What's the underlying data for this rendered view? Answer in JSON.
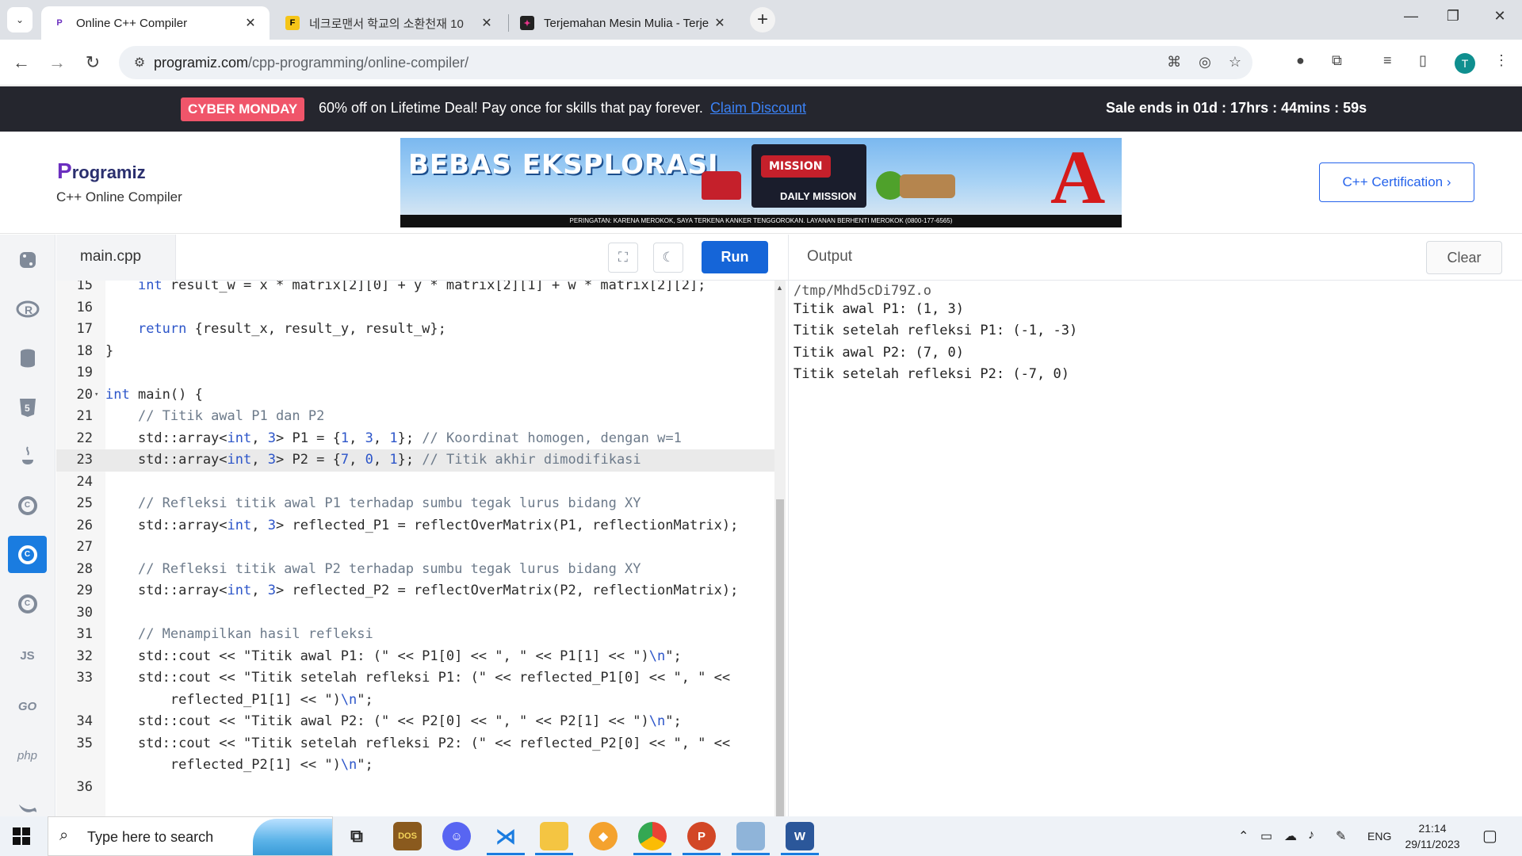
{
  "browser": {
    "tabs": [
      {
        "title": "Online C++ Compiler",
        "active": true,
        "favicon": "programiz-icon"
      },
      {
        "title": "네크로맨서 학교의 소환천재 10",
        "active": false,
        "favicon": "webtoon-icon"
      },
      {
        "title": "Terjemahan Mesin Mulia - Terje",
        "active": false,
        "favicon": "site-icon"
      }
    ],
    "url_domain": "programiz.com",
    "url_path": "/cpp-programming/online-compiler/",
    "profile_initial": "T"
  },
  "promo": {
    "badge": "CYBER MONDAY",
    "message": "60% off on Lifetime Deal! Pay once for skills that pay forever.",
    "link": "Claim Discount",
    "timer": "Sale ends in 01d : 17hrs : 44mins : 59s"
  },
  "header": {
    "logo_p": "P",
    "logo_rest": "rogramiz",
    "subtitle": "C++ Online Compiler",
    "cert_button": "C++ Certification ›"
  },
  "ad": {
    "title": "BEBAS EKSPLORASI",
    "mission": "MISSION",
    "daily": "DAILY MISSION",
    "brand": "A",
    "warning": "PERINGATAN: KARENA MEROKOK, SAYA TERKENA KANKER TENGGOROKAN. LAYANAN BERHENTI MEROKOK (0800-177-6565)"
  },
  "sidebar": {
    "langs": [
      "python",
      "r",
      "sql",
      "html",
      "java",
      "c",
      "cpp",
      "csharp",
      "JS",
      "GO",
      "php",
      "swift"
    ],
    "js_label": "JS",
    "go_label": "GO",
    "php_label": "php"
  },
  "editor": {
    "file_name": "main.cpp",
    "run_label": "Run",
    "lines": [
      {
        "n": "15",
        "html": "    <span class=\"kw\">int</span> result_w = x * matrix[2][0] + y * matrix[2][1] + w * matrix[2][2];"
      },
      {
        "n": "16",
        "html": ""
      },
      {
        "n": "17",
        "html": "    <span class=\"kw\">return</span> {result_x, result_y, result_w};"
      },
      {
        "n": "18",
        "html": "}"
      },
      {
        "n": "19",
        "html": ""
      },
      {
        "n": "20",
        "html": "<span class=\"kw\">int</span> main() {",
        "fold": true
      },
      {
        "n": "21",
        "html": "    <span class=\"cm\">// Titik awal P1 dan P2</span>"
      },
      {
        "n": "22",
        "html": "    std::array&lt;<span class=\"kw\">int</span>, <span class=\"kw\">3</span>&gt; P1 = {<span class=\"kw\">1</span>, <span class=\"kw\">3</span>, <span class=\"kw\">1</span>}; <span class=\"cm\">// Koordinat homogen, dengan w=1</span>"
      },
      {
        "n": "23",
        "html": "    std::array&lt;<span class=\"kw\">int</span>, <span class=\"kw\">3</span>&gt; P2 = {<span class=\"kw\">7</span>, <span class=\"kw\">0</span>, <span class=\"kw\">1</span>}; <span class=\"cm\">// Titik akhir dimodifikasi</span>",
        "highlight": true
      },
      {
        "n": "24",
        "html": ""
      },
      {
        "n": "25",
        "html": "    <span class=\"cm\">// Refleksi titik awal P1 terhadap sumbu tegak lurus bidang XY</span>"
      },
      {
        "n": "26",
        "html": "    std::array&lt;<span class=\"kw\">int</span>, <span class=\"kw\">3</span>&gt; reflected_P1 = reflectOverMatrix(P1, reflectionMatrix);"
      },
      {
        "n": "27",
        "html": ""
      },
      {
        "n": "28",
        "html": "    <span class=\"cm\">// Refleksi titik awal P2 terhadap sumbu tegak lurus bidang XY</span>"
      },
      {
        "n": "29",
        "html": "    std::array&lt;<span class=\"kw\">int</span>, <span class=\"kw\">3</span>&gt; reflected_P2 = reflectOverMatrix(P2, reflectionMatrix);"
      },
      {
        "n": "30",
        "html": ""
      },
      {
        "n": "31",
        "html": "    <span class=\"cm\">// Menampilkan hasil refleksi</span>"
      },
      {
        "n": "32",
        "html": "    std::cout &lt;&lt; \"Titik awal P1: (\" &lt;&lt; P1[0] &lt;&lt; \", \" &lt;&lt; P1[1] &lt;&lt; \")<span class=\"kw\">\\n</span>\";"
      },
      {
        "n": "33",
        "html": "    std::cout &lt;&lt; \"Titik setelah refleksi P1: (\" &lt;&lt; reflected_P1[0] &lt;&lt; \", \" &lt;&lt;"
      },
      {
        "n": "",
        "html": "        reflected_P1[1] &lt;&lt; \")<span class=\"kw\">\\n</span>\";"
      },
      {
        "n": "34",
        "html": "    std::cout &lt;&lt; \"Titik awal P2: (\" &lt;&lt; P2[0] &lt;&lt; \", \" &lt;&lt; P2[1] &lt;&lt; \")<span class=\"kw\">\\n</span>\";"
      },
      {
        "n": "35",
        "html": "    std::cout &lt;&lt; \"Titik setelah refleksi P2: (\" &lt;&lt; reflected_P2[0] &lt;&lt; \", \" &lt;&lt;"
      },
      {
        "n": "",
        "html": "        reflected_P2[1] &lt;&lt; \")<span class=\"kw\">\\n</span>\";"
      },
      {
        "n": "",
        "html": ""
      },
      {
        "n": "36",
        "html": ""
      }
    ]
  },
  "output": {
    "title": "Output",
    "clear_label": "Clear",
    "lines": [
      "/tmp/Mhd5cDi79Z.o",
      "Titik awal P1: (1, 3)",
      "Titik setelah refleksi P1: (-1, -3)",
      "Titik awal P2: (7, 0)",
      "Titik setelah refleksi P2: (-7, 0)"
    ]
  },
  "taskbar": {
    "search_placeholder": "Type here to search",
    "language": "ENG",
    "time": "21:14",
    "date": "29/11/2023",
    "apps": [
      "task-view",
      "dos-game",
      "discord",
      "vscode",
      "file-explorer",
      "brave",
      "chrome",
      "powerpoint",
      "notepad",
      "word"
    ]
  }
}
